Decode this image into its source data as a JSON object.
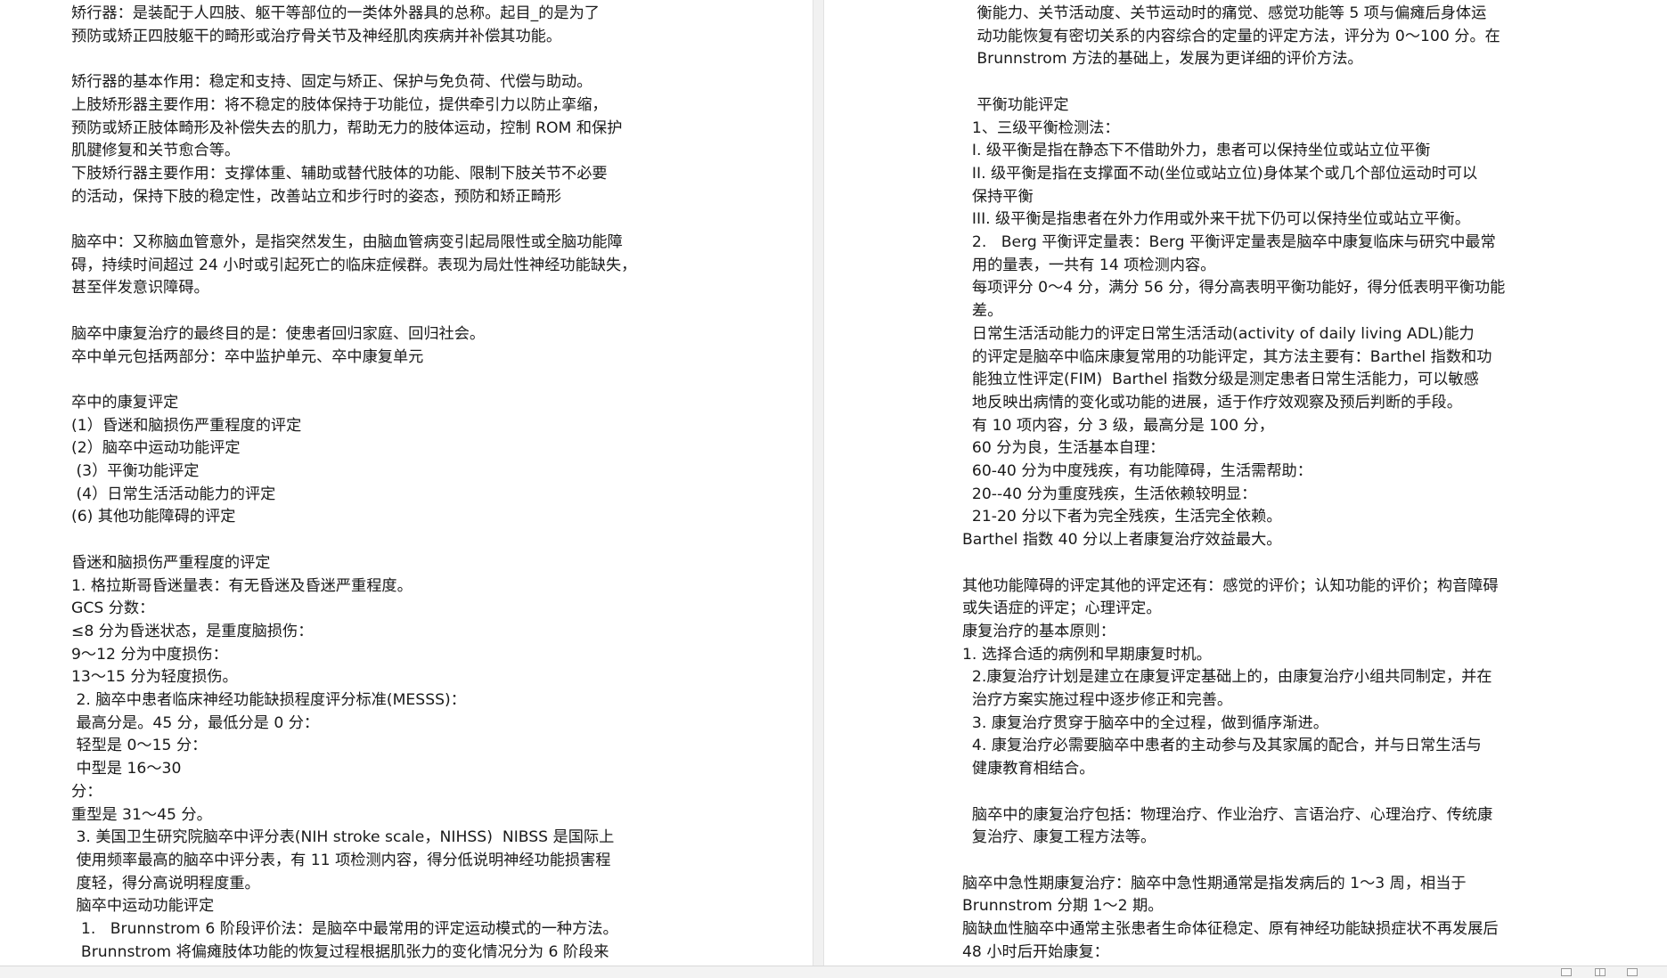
{
  "left_page": {
    "lines": [
      "矫行器：是装配于人四肢、躯干等部位的一类体外器具的总称。起目_的是为了",
      "预防或矫正四肢躯干的畸形或治疗骨关节及神经肌肉疾病并补偿其功能。",
      "",
      "矫行器的基本作用：稳定和支持、固定与矫正、保护与免负荷、代偿与助动。",
      "上肢矫形器主要作用：将不稳定的肢体保持于功能位，提供牵引力以防止挛缩，",
      "预防或矫正肢体畸形及补偿失去的肌力，帮助无力的肢体运动，控制 ROM 和保护",
      "肌腱修复和关节愈合等。",
      "下肢矫行器主要作用：支撑体重、辅助或替代肢体的功能、限制下肢关节不必要",
      "的活动，保持下肢的稳定性，改善站立和步行时的姿态，预防和矫正畸形",
      "",
      "脑卒中：又称脑血管意外，是指突然发生，由脑血管病变引起局限性或全脑功能障",
      "碍，持续时间超过 24 小时或引起死亡的临床症候群。表现为局灶性神经功能缺失，",
      "甚至伴发意识障碍。",
      "",
      "脑卒中康复治疗的最终目的是：使患者回归家庭、回归社会。",
      "卒中单元包括两部分：卒中监护单元、卒中康复单元",
      "",
      "卒中的康复评定",
      "(1）昏迷和脑损伤严重程度的评定",
      "(2）脑卒中运动功能评定",
      " (3）平衡功能评定",
      " (4）日常生活活动能力的评定",
      "(6) 其他功能障碍的评定",
      "",
      "昏迷和脑损伤严重程度的评定",
      "1. 格拉斯哥昏迷量表：有无昏迷及昏迷严重程度。",
      "GCS 分数：",
      "≤8 分为昏迷状态，是重度脑损伤：",
      "9～12 分为中度损伤：",
      "13～15 分为轻度损伤。",
      " 2. 脑卒中患者临床神经功能缺损程度评分标准(MESSS)：",
      " 最高分是。45 分，最低分是 0 分：",
      " 轻型是 0～15 分：",
      " 中型是 16～30",
      "分：",
      "重型是 31～45 分。",
      " 3. 美国卫生研究院脑卒中评分表(NIH stroke scale，NIHSS)  NIBSS 是国际上",
      " 使用频率最高的脑卒中评分表，有 11 项检测内容，得分低说明神经功能损害程",
      " 度轻，得分高说明程度重。",
      " 脑卒中运动功能评定",
      "  1.   Brunnstrom 6 阶段评价法：是脑卒中最常用的评定运动模式的一种方法。",
      "  Brunnstrom 将偏瘫肢体功能的恢复过程根据肌张力的变化情况分为 6 阶段来"
    ]
  },
  "right_page": {
    "lines": [
      "   衡能力、关节活动度、关节运动时的痛觉、感觉功能等 5 项与偏瘫后身体运",
      "   动功能恢复有密切关系的内容综合的定量的评定方法，评分为 0～100 分。在",
      "   Brunnstrom 方法的基础上，发展为更详细的评价方法。",
      "",
      "   平衡功能评定",
      "  1、三级平衡检测法：",
      "  I. 级平衡是指在静态下不借助外力，患者可以保持坐位或站立位平衡",
      "  II. 级平衡是指在支撑面不动(坐位或站立位)身体某个或几个部位运动时可以",
      "  保持平衡",
      "  III. 级平衡是指患者在外力作用或外来干扰下仍可以保持坐位或站立平衡。",
      "  2.   Berg 平衡评定量表：Berg 平衡评定量表是脑卒中康复临床与研究中最常",
      "  用的量表，一共有 14 项检测内容。",
      "  每项评分 0～4 分，满分 56 分，得分高表明平衡功能好，得分低表明平衡功能",
      "  差。",
      "  日常生活活动能力的评定日常生活活动(activity of daily living ADL)能力",
      "  的评定是脑卒中临床康复常用的功能评定，其方法主要有：Barthel 指数和功",
      "  能独立性评定(FIM)  Barthel 指数分级是测定患者日常生活能力，可以敏感",
      "  地反映出病情的变化或功能的进展，适于作疗效观察及预后判断的手段。",
      "  有 10 项内容，分 3 级，最高分是 100 分，",
      "  60 分为良，生活基本自理：",
      "  60-40 分为中度残疾，有功能障碍，生活需帮助：",
      "  20--40 分为重度残疾，生活依赖较明显：",
      "  21-20 分以下者为完全残疾，生活完全依赖。",
      "Barthel 指数 40 分以上者康复治疗效益最大。",
      "",
      "其他功能障碍的评定其他的评定还有：感觉的评价；认知功能的评价；构音障碍",
      "或失语症的评定；心理评定。",
      "康复治疗的基本原则：",
      "1. 选择合适的病例和早期康复时机。",
      "  2.康复治疗计划是建立在康复评定基础上的，由康复治疗小组共同制定，并在",
      "  治疗方案实施过程中逐步修正和完善。",
      "  3. 康复治疗贯穿于脑卒中的全过程，做到循序渐进。",
      "  4. 康复治疗必需要脑卒中患者的主动参与及其家属的配合，并与日常生活与",
      "  健康教育相结合。",
      "",
      "  脑卒中的康复治疗包括：物理治疗、作业治疗、言语治疗、心理治疗、传统康",
      "  复治疗、康复工程方法等。",
      "",
      "脑卒中急性期康复治疗：脑卒中急性期通常是指发病后的 1～3 周，相当于",
      "Brunnstrom 分期 1～2 期。",
      "脑缺血性脑卒中通常主张患者生命体征稳定、原有神经功能缺损症状不再发展后",
      "48 小时后开始康复："
    ]
  }
}
